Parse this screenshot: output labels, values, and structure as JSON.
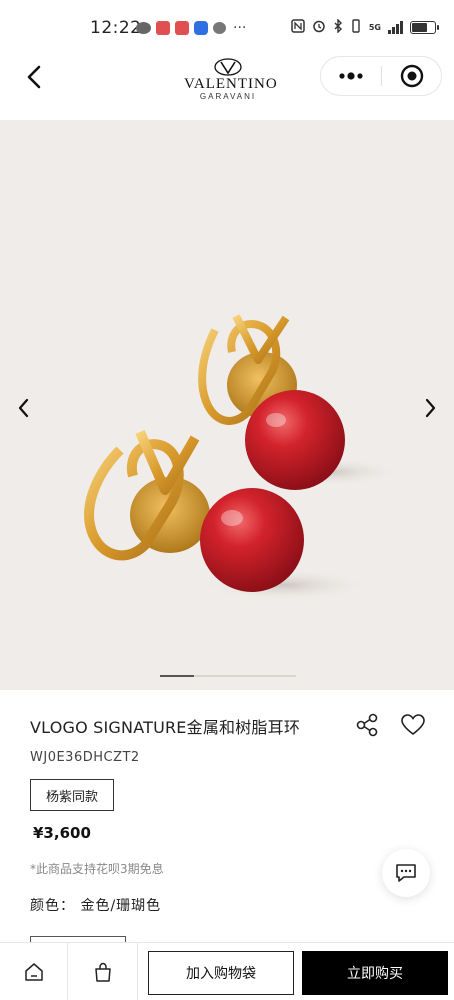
{
  "status_bar": {
    "time": "12:22",
    "more_dots": "···",
    "network": "5G",
    "battery_level": 0.7
  },
  "header": {
    "brand_name": "VALENTINO",
    "brand_sub": "GARAVANI",
    "icons": {
      "back": "chevron-left-icon",
      "more": "more-dots-icon",
      "close": "target-close-icon"
    }
  },
  "gallery": {
    "image_subject": "VLogo Signature gold earrings with red resin pearls",
    "colors": {
      "background": "#efece9",
      "gold": "#d9a53a",
      "coral": "#c8202a"
    },
    "progress": 0.25
  },
  "product": {
    "title": "VLOGO SIGNATURE金属和树脂耳环",
    "sku": "WJ0E36DHCZT2",
    "tag": "杨紫同款",
    "price": "¥3,600",
    "installment": "*此商品支持花呗3期免息",
    "color_label": "颜色：",
    "color_value": "金色/珊瑚色"
  },
  "bottom_bar": {
    "add_to_cart": "加入购物袋",
    "buy_now": "立即购买"
  }
}
